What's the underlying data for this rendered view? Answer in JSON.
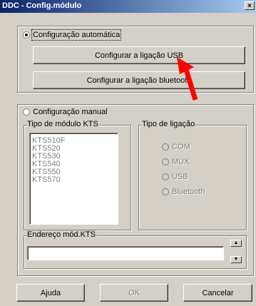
{
  "window": {
    "title": "DDC - Config.módulo",
    "close_glyph": "×"
  },
  "auto_config": {
    "label": "Configuração automática",
    "selected": true,
    "usb_button": "Configurar a ligação USB",
    "bluetooth_button": "Configurar a ligação bluetooth"
  },
  "manual_config": {
    "label": "Configuração manual",
    "selected": false,
    "module_type": {
      "legend": "Tipo de módulo KTS",
      "items": [
        "KTS510F",
        "KTS520",
        "KTS530",
        "KTS540",
        "KTS550",
        "KTS570"
      ]
    },
    "connection_type": {
      "legend": "Tipo de ligação",
      "options": [
        "COM",
        "MUX",
        "USB",
        "Bluetooth"
      ]
    },
    "address": {
      "legend": "Endereço mód.KTS",
      "value": ""
    }
  },
  "footer": {
    "help": "Ajuda",
    "ok": "OK",
    "cancel": "Cancelar"
  },
  "annotation": {
    "arrow_color": "#ff0000",
    "target": "usb-config-button"
  }
}
